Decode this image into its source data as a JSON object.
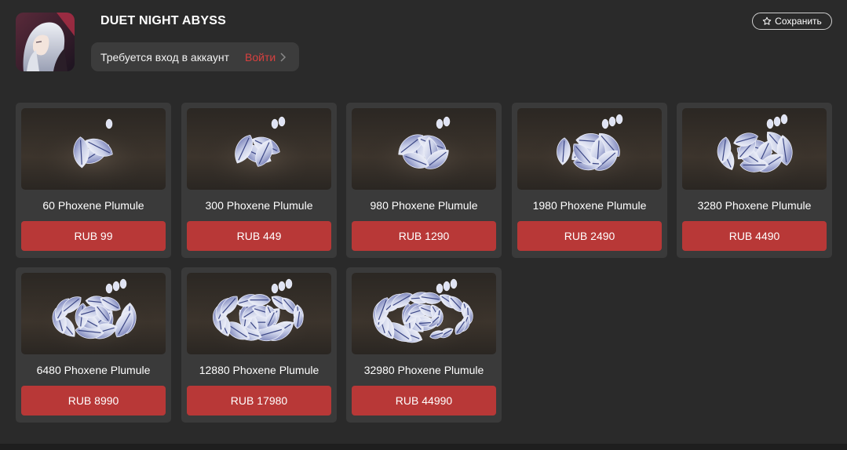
{
  "header": {
    "game_title": "DUET NIGHT ABYSS",
    "login_prompt": "Требуется вход в аккаунт",
    "login_link": "Войти",
    "save_label": "Сохранить"
  },
  "colors": {
    "accent": "#b83837",
    "link": "#d8403f",
    "panel": "#2a2a2a",
    "card": "#3a3a3a"
  },
  "icons": {
    "save": "star-outline-icon",
    "login": "chevron-right-icon"
  },
  "products": [
    {
      "name": "60 Phoxene Plumule",
      "price": "RUB 99",
      "tier": 1
    },
    {
      "name": "300 Phoxene Plumule",
      "price": "RUB 449",
      "tier": 2
    },
    {
      "name": "980 Phoxene Plumule",
      "price": "RUB 1290",
      "tier": 3
    },
    {
      "name": "1980 Phoxene Plumule",
      "price": "RUB 2490",
      "tier": 4
    },
    {
      "name": "3280 Phoxene Plumule",
      "price": "RUB 4490",
      "tier": 5
    },
    {
      "name": "6480 Phoxene Plumule",
      "price": "RUB 8990",
      "tier": 6
    },
    {
      "name": "12880 Phoxene Plumule",
      "price": "RUB 17980",
      "tier": 7
    },
    {
      "name": "32980 Phoxene Plumule",
      "price": "RUB 44990",
      "tier": 8
    }
  ]
}
